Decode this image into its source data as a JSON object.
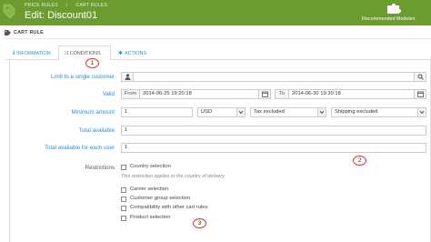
{
  "header": {
    "breadcrumbs": [
      "PRICE RULES",
      "CART RULES"
    ],
    "breadcrumb_separator": "/",
    "title": "Edit: Discount01",
    "recommended_label": "Recommended Modules",
    "brand_color": "#6c9b2f"
  },
  "panel": {
    "icon": "tag-icon",
    "title": "CART RULE"
  },
  "tabs": [
    {
      "label": "INFORMATION",
      "icon": "info-icon",
      "active": false
    },
    {
      "label": "CONDITIONS",
      "icon": "shuffle-icon",
      "active": true
    },
    {
      "label": "ACTIONS",
      "icon": "actions-icon",
      "active": false
    }
  ],
  "form": {
    "limit_customer_label": "Limit to a single customer",
    "limit_customer_value": "",
    "valid_label": "Valid",
    "from_label": "From",
    "from_value": "2014-06-25 19:20:18",
    "to_label": "To",
    "to_value": "2014-06-30 19:20:18",
    "min_amount_label": "Minimum amount",
    "min_amount_value": "1",
    "currency_value": "USD",
    "tax_value": "Tax excluded",
    "shipping_value": "Shipping excluded",
    "total_available_label": "Total available",
    "total_available_value": "1",
    "total_per_user_label": "Total available for each user",
    "total_per_user_value": "1",
    "restrictions_label": "Restrictions",
    "country_selection": "Country selection",
    "country_hint": "This restriction applies to the country of delivery.",
    "carrier_selection": "Carrier selection",
    "customer_group_selection": "Customer group selection",
    "compat_cart_rules": "Compatibility with other cart rules",
    "product_selection": "Product selection"
  },
  "annotations": [
    "1",
    "2",
    "3"
  ]
}
